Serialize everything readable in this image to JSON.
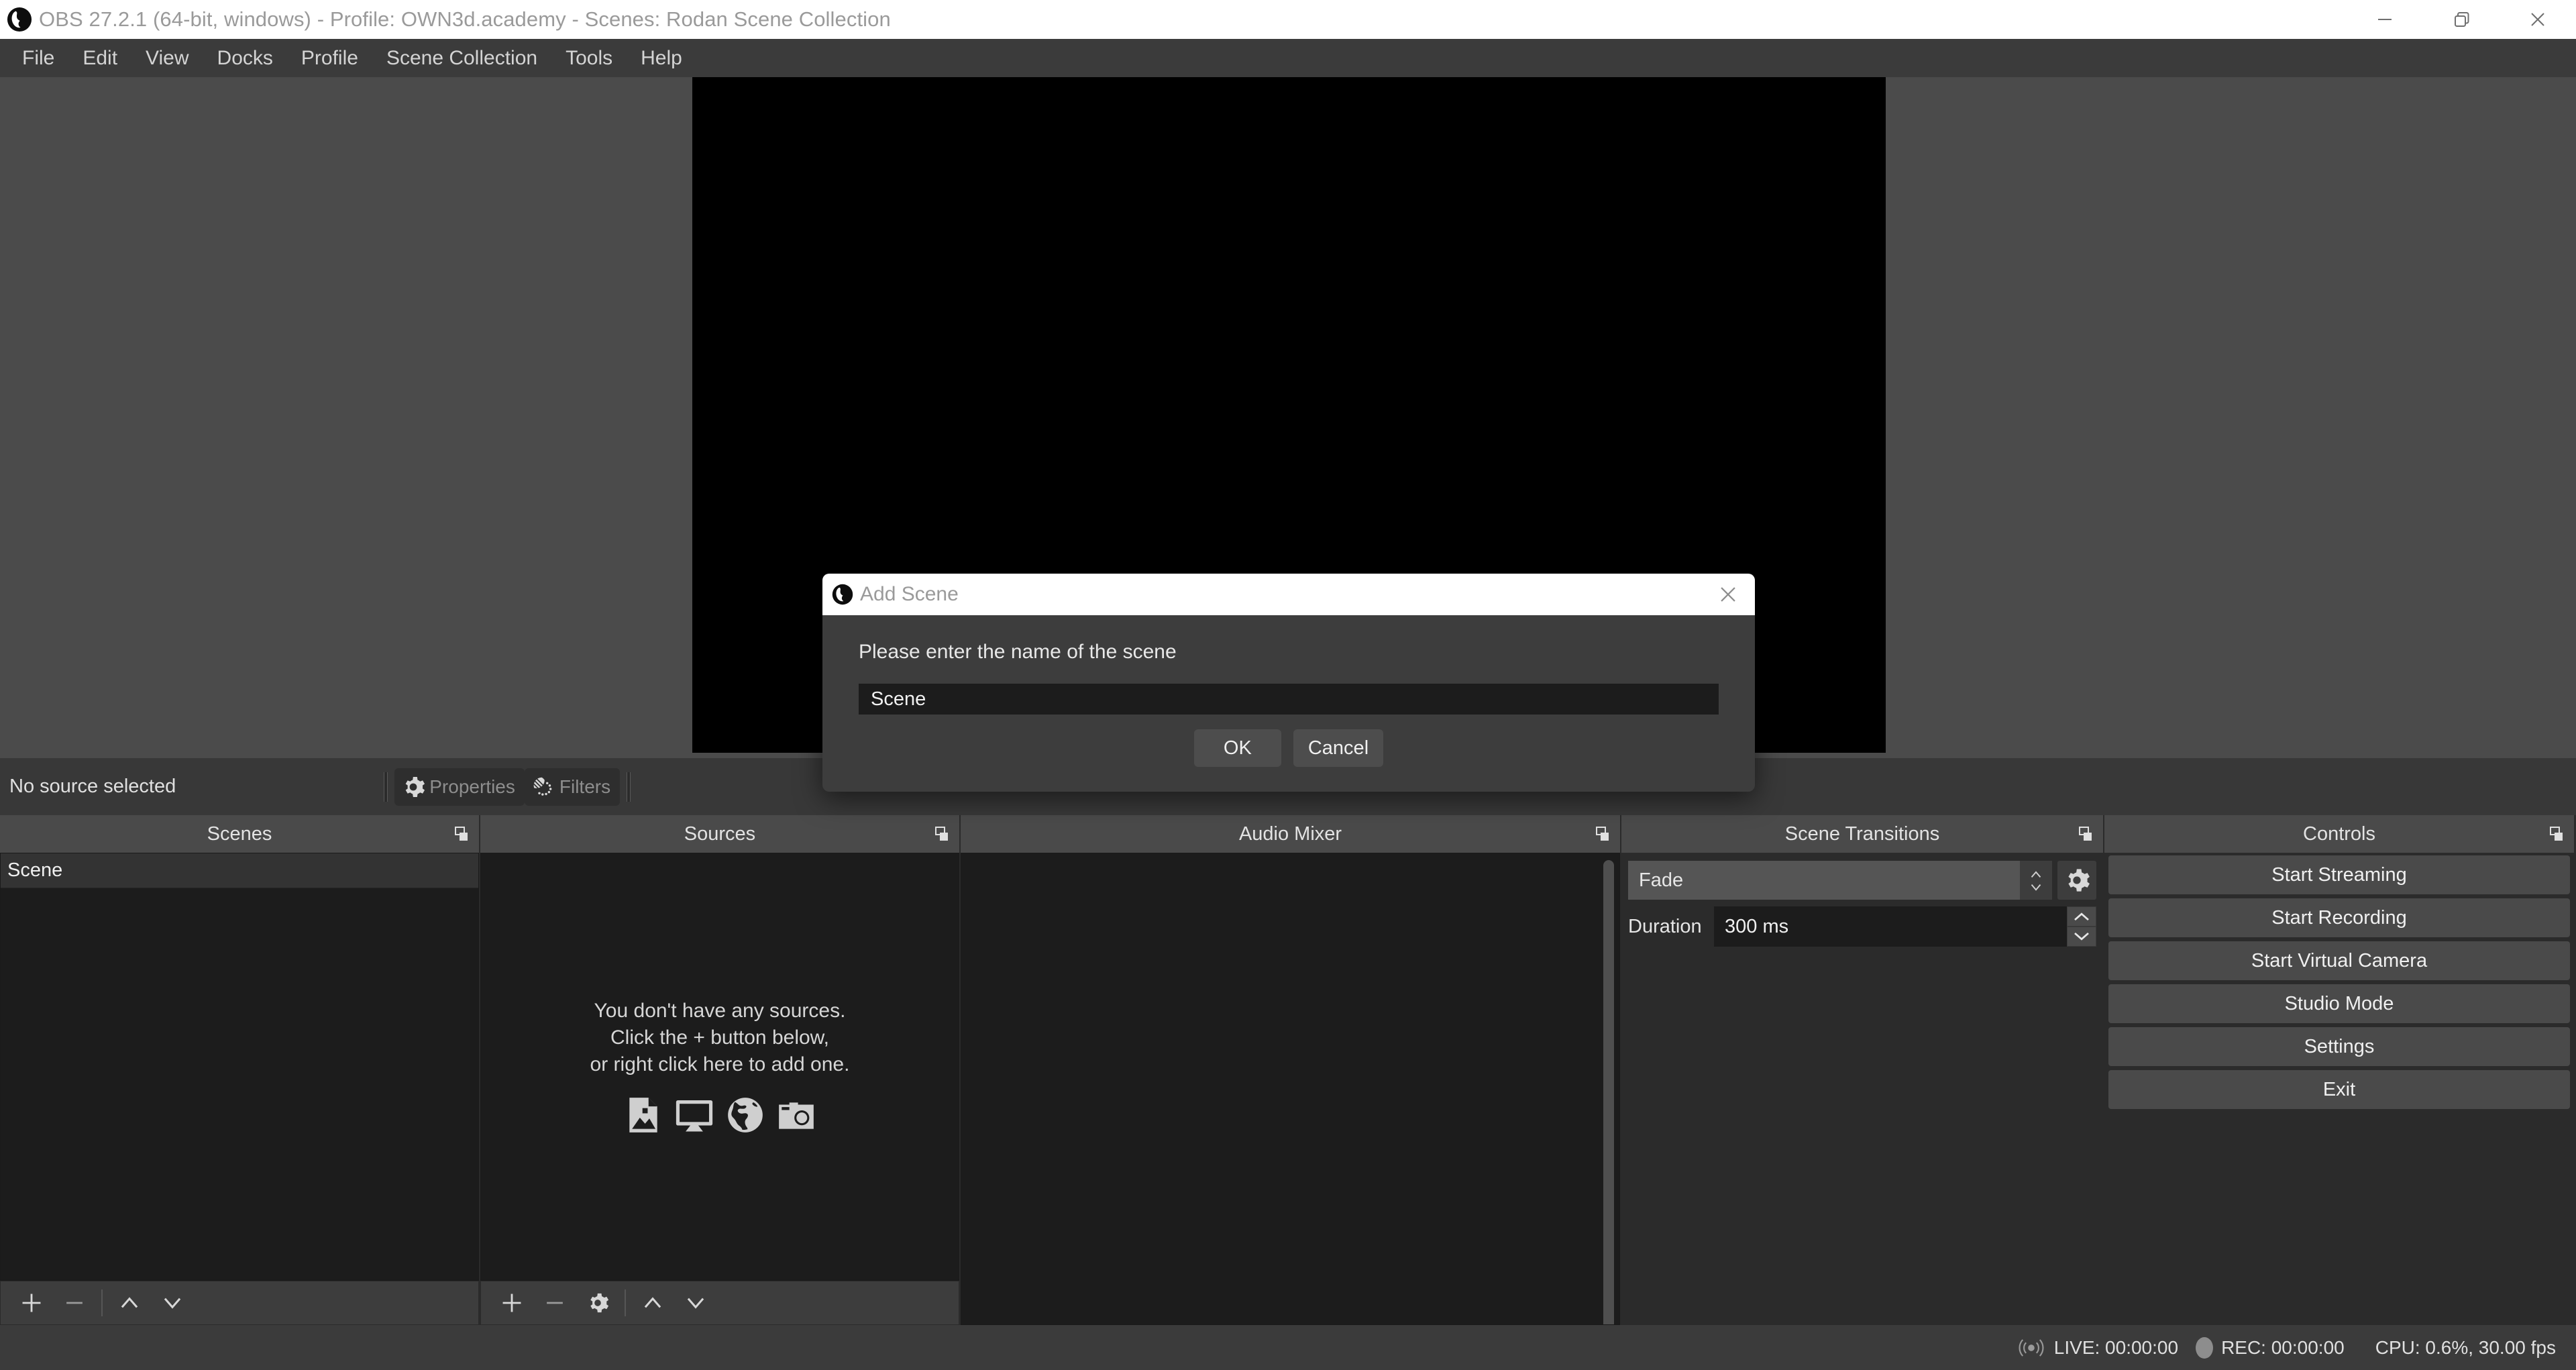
{
  "window": {
    "title": "OBS 27.2.1 (64-bit, windows) - Profile: OWN3d.academy - Scenes: Rodan Scene Collection",
    "logo_icon": "obs-logo-icon",
    "minimize_icon": "minimize-icon",
    "maximize_icon": "restore-icon",
    "close_icon": "close-icon"
  },
  "menubar": {
    "items": [
      {
        "label": "File"
      },
      {
        "label": "Edit"
      },
      {
        "label": "View"
      },
      {
        "label": "Docks"
      },
      {
        "label": "Profile"
      },
      {
        "label": "Scene Collection"
      },
      {
        "label": "Tools"
      },
      {
        "label": "Help"
      }
    ]
  },
  "preview": {
    "canvas_color": "#000000",
    "backdrop_color": "#4b4b4b"
  },
  "source_toolbar": {
    "status_label": "No source selected",
    "properties_label": "Properties",
    "properties_icon": "gear-icon",
    "filters_label": "Filters",
    "filters_icon": "filters-icon"
  },
  "docks": {
    "scenes": {
      "title": "Scenes",
      "float_icon": "float-dock-icon",
      "items": [
        {
          "label": "Scene",
          "selected": true
        }
      ],
      "footer": {
        "add_icon": "plus-icon",
        "remove_icon": "minus-icon",
        "move_up_icon": "chevron-up-icon",
        "move_down_icon": "chevron-down-icon"
      }
    },
    "sources": {
      "title": "Sources",
      "float_icon": "float-dock-icon",
      "empty_lines": [
        "You don't have any sources.",
        "Click the + button below,",
        "or right click here to add one."
      ],
      "empty_icons": [
        "image-icon",
        "display-icon",
        "browser-icon",
        "camera-icon"
      ],
      "footer": {
        "add_icon": "plus-icon",
        "remove_icon": "minus-icon",
        "properties_icon": "gear-icon",
        "move_up_icon": "chevron-up-icon",
        "move_down_icon": "chevron-down-icon"
      }
    },
    "audio_mixer": {
      "title": "Audio Mixer",
      "float_icon": "float-dock-icon"
    },
    "scene_transitions": {
      "title": "Scene Transitions",
      "float_icon": "float-dock-icon",
      "transition_value": "Fade",
      "transition_spinner_icon": "updown-arrows-icon",
      "config_icon": "gear-icon",
      "duration_label": "Duration",
      "duration_value": "300 ms",
      "duration_up_icon": "chevron-up-icon",
      "duration_down_icon": "chevron-down-icon"
    },
    "controls": {
      "title": "Controls",
      "float_icon": "float-dock-icon",
      "buttons": [
        {
          "label": "Start Streaming"
        },
        {
          "label": "Start Recording"
        },
        {
          "label": "Start Virtual Camera"
        },
        {
          "label": "Studio Mode"
        },
        {
          "label": "Settings"
        },
        {
          "label": "Exit"
        }
      ]
    }
  },
  "statusbar": {
    "live_icon": "broadcast-icon",
    "live_text": "LIVE: 00:00:00",
    "rec_icon": "record-dot-icon",
    "rec_text": "REC: 00:00:00",
    "cpu_text": "CPU: 0.6%, 30.00 fps"
  },
  "dialog": {
    "logo_icon": "obs-logo-icon",
    "title": "Add Scene",
    "close_icon": "close-icon",
    "prompt": "Please enter the name of the scene",
    "input_value": "Scene",
    "ok_label": "OK",
    "cancel_label": "Cancel"
  }
}
